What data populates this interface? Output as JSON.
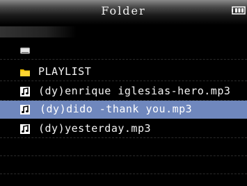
{
  "header": {
    "title": "Folder",
    "battery_icon": "battery-icon"
  },
  "list": {
    "selected_index": 4,
    "items": [
      {
        "icon": "drive-icon",
        "label": ""
      },
      {
        "icon": "folder-icon",
        "label": "PLAYLIST"
      },
      {
        "icon": "music-note-icon",
        "label": "(dy)enrique iglesias-hero.mp3"
      },
      {
        "icon": "music-note-icon",
        "label": "(dy)dido -thank you.mp3"
      },
      {
        "icon": "music-note-icon",
        "label": "(dy)yesterday.mp3"
      }
    ]
  },
  "colors": {
    "selection": "#6f87bd",
    "folder": "#f5c400",
    "background": "#000000"
  }
}
